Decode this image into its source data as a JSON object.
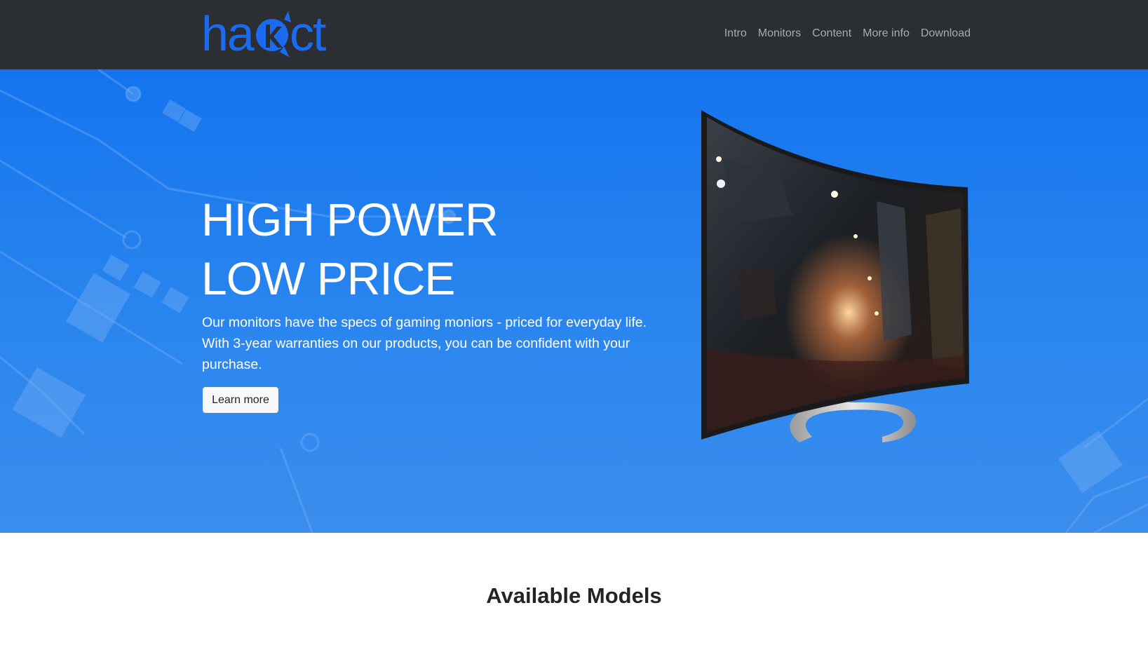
{
  "brand": {
    "name": "hakct",
    "logo_color": "#1a6bf0"
  },
  "nav": {
    "links": [
      {
        "label": "Intro"
      },
      {
        "label": "Monitors"
      },
      {
        "label": "Content"
      },
      {
        "label": "More info"
      },
      {
        "label": "Download"
      }
    ]
  },
  "hero": {
    "title_line1": "HIGH POWER",
    "title_line2": "LOW PRICE",
    "text": "Our monitors have the specs of gaming moniors - priced for everyday life. With 3-year warranties on our products, you can be confident with your purchase.",
    "button_label": "Learn more",
    "background_color": "#1474ef"
  },
  "models": {
    "title": "Available Models"
  },
  "colors": {
    "navbar": "#2b2e33",
    "accent": "#1a6bf0"
  }
}
